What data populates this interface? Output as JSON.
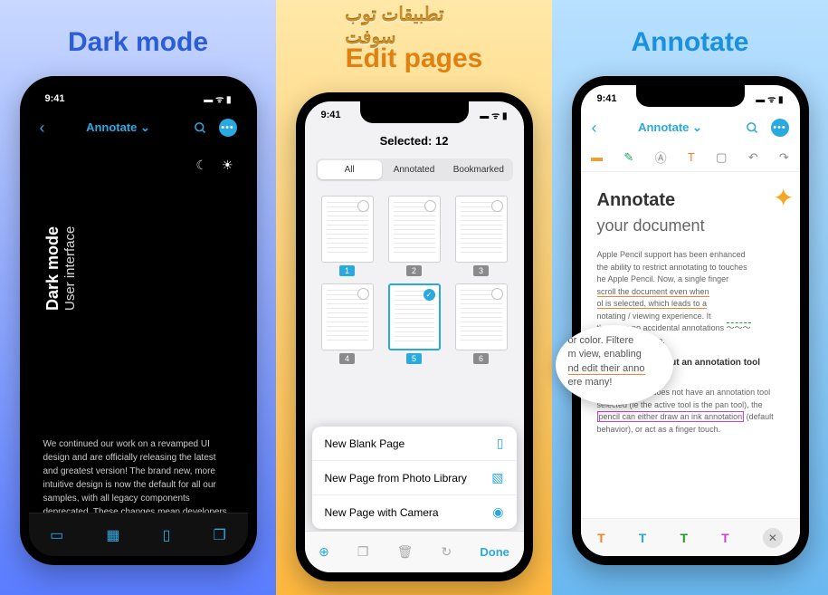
{
  "banner": "تطبيقات توب سوفت",
  "panels": {
    "p1": {
      "heading": "Dark mode",
      "status_time": "9:41",
      "nav_title": "Annotate ⌄",
      "dark_title1": "Dark mode",
      "dark_title2": "User interface",
      "body_text": "We continued our work on a revamped UI design and are officially releasing the latest and greatest version! The brand new, more intuitive design is now the default for all our samples, with all legacy components deprecated. These changes mean developers"
    },
    "p2": {
      "heading": "Edit pages",
      "status_time": "9:41",
      "sel_title": "Selected: 12",
      "seg": {
        "a": "All",
        "b": "Annotated",
        "c": "Bookmarked"
      },
      "thumbs": [
        "1",
        "2",
        "3",
        "4",
        "5",
        "6"
      ],
      "sheet": {
        "a": "New Blank Page",
        "b": "New Page from Photo Library",
        "c": "New Page with Camera"
      },
      "done": "Done"
    },
    "p3": {
      "heading": "Annotate",
      "status_time": "9:41",
      "nav_title": "Annotate ⌄",
      "doc_h1": "Annotate",
      "doc_h2": "your document",
      "para1a": "Apple Pencil support has been enhanced",
      "para1b": "the ability to restrict annotating to touches",
      "para1c": "he Apple Pencil. Now, a single finger",
      "para1d": "scroll the document even when",
      "para1e": "ol is selected, which leads to a",
      "para1f": "notating / viewing experience. It",
      "para1g": "there are no accidental annotations",
      "para1h": "by the user's palm.",
      "sub": "Annotating without an annotation tool selected",
      "para2a": "When the user does not have an annotation tool selected (ie the active tool is the pan tool), the ",
      "para2b": "pencil can either draw an ink annotation",
      "para2c": " (default behavior), or act as a finger touch.",
      "mag1": "or color. Filtere",
      "mag2": "m view, enabling",
      "mag3": "nd edit their anno",
      "mag4": "ere many!"
    }
  }
}
